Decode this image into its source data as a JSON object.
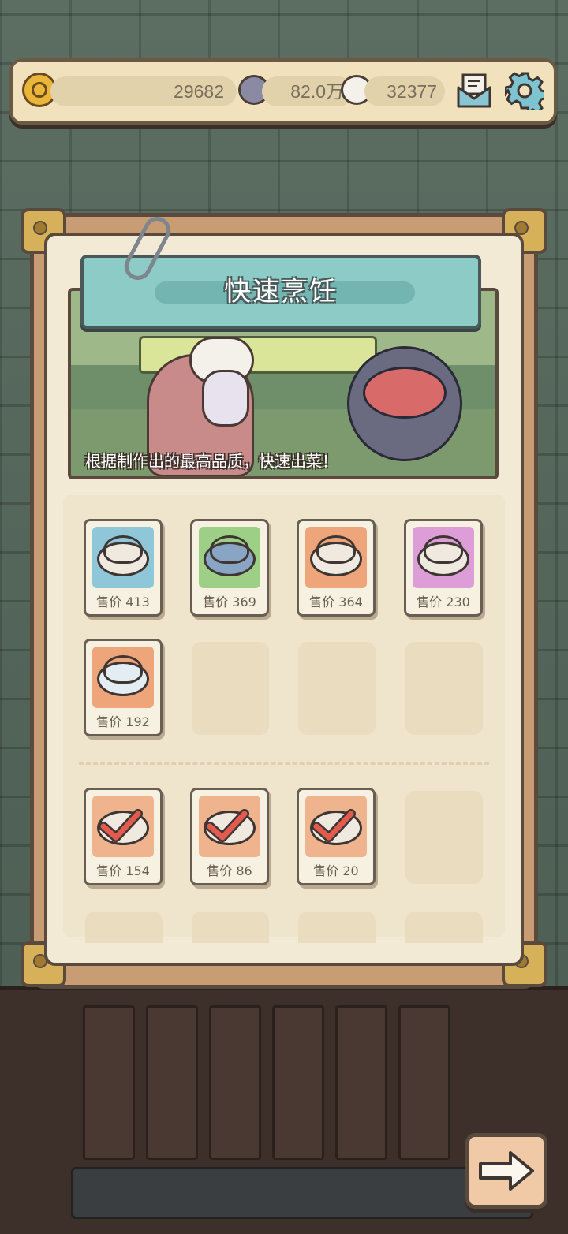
{
  "resources": {
    "coins": "29682",
    "currency2": "82.0万",
    "currency3": "32377"
  },
  "panel": {
    "title": "快速烹饪",
    "caption": "根据制作出的最高品质，快速出菜！"
  },
  "dishes": [
    {
      "price_label": "售价 413",
      "bg": "#8fc7d8",
      "food": "#d97a8a"
    },
    {
      "price_label": "售价 369",
      "bg": "#9ecf86",
      "food": "#d98a6a"
    },
    {
      "price_label": "售价 364",
      "bg": "#eea57a",
      "food": "#8ed08a"
    },
    {
      "price_label": "售价 230",
      "bg": "#dd9ed8",
      "food": "#6fb8c0"
    },
    {
      "price_label": "售价 192",
      "bg": "#eea57a",
      "food": "#92c777"
    }
  ],
  "selected_dishes": [
    {
      "price_label": "售价 154",
      "bg": "#efb48e"
    },
    {
      "price_label": "售价 86",
      "bg": "#efb48e"
    },
    {
      "price_label": "售价 20",
      "bg": "#efb48e"
    }
  ],
  "colors": {
    "accent_teal": "#8ccbc6",
    "check_red": "#e35b4f"
  }
}
